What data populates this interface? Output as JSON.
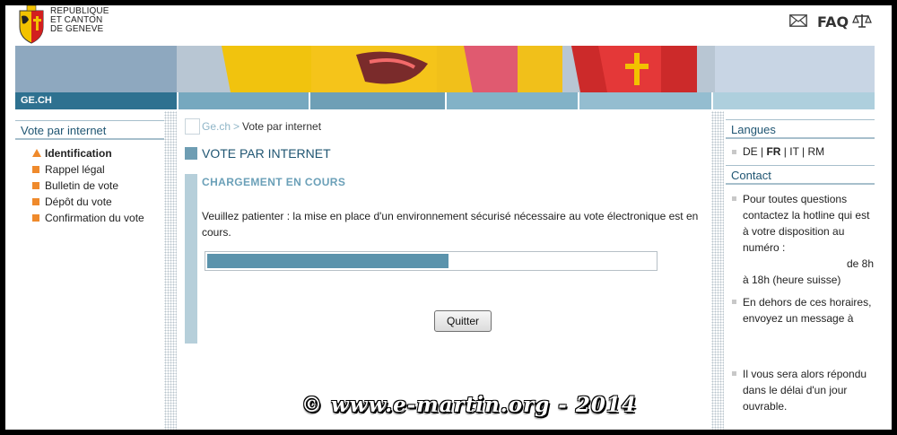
{
  "header": {
    "org_line1": "REPUBLIQUE",
    "org_line2": "ET CANTON",
    "org_line3": "DE GENEVE",
    "faq_label": "FAQ",
    "mail_icon": "mail-icon",
    "scale_icon": "scale-icon"
  },
  "nav": {
    "site_tab": "GE.CH"
  },
  "left_menu": {
    "title": "Vote par internet",
    "items": [
      {
        "label": "Identification",
        "active": true
      },
      {
        "label": "Rappel légal"
      },
      {
        "label": "Bulletin de vote"
      },
      {
        "label": "Dépôt du vote"
      },
      {
        "label": "Confirmation du vote"
      }
    ]
  },
  "breadcrumb": {
    "home": "Ge.ch",
    "separator": ">",
    "current": "Vote par internet"
  },
  "main": {
    "page_title": "VOTE PAR INTERNET",
    "loading_title": "CHARGEMENT EN COURS",
    "message": "Veuillez patienter : la mise en place d'un environnement sécurisé nécessaire au vote électronique est en cours.",
    "progress_fraction": 0.54,
    "quit_label": "Quitter"
  },
  "right": {
    "languages_title": "Langues",
    "languages": {
      "de": "DE",
      "fr": "FR",
      "it": "IT",
      "rm": "RM",
      "sep": " | "
    },
    "contact_title": "Contact",
    "contact_p1": "Pour toutes questions contactez la hotline qui est à votre disposition au numéro :",
    "contact_p1b": "de 8h",
    "contact_p1c": "à 18h (heure suisse)",
    "contact_p2": "En dehors de ces horaires, envoyez un message à",
    "contact_p3": "Il vous sera alors répondu dans le délai d'un jour ouvrable."
  },
  "watermark": "© www.e-martin.org - 2014",
  "colors": {
    "accent": "#2e7190",
    "bullet": "#ef8a2c",
    "progress": "#5b93ac"
  }
}
